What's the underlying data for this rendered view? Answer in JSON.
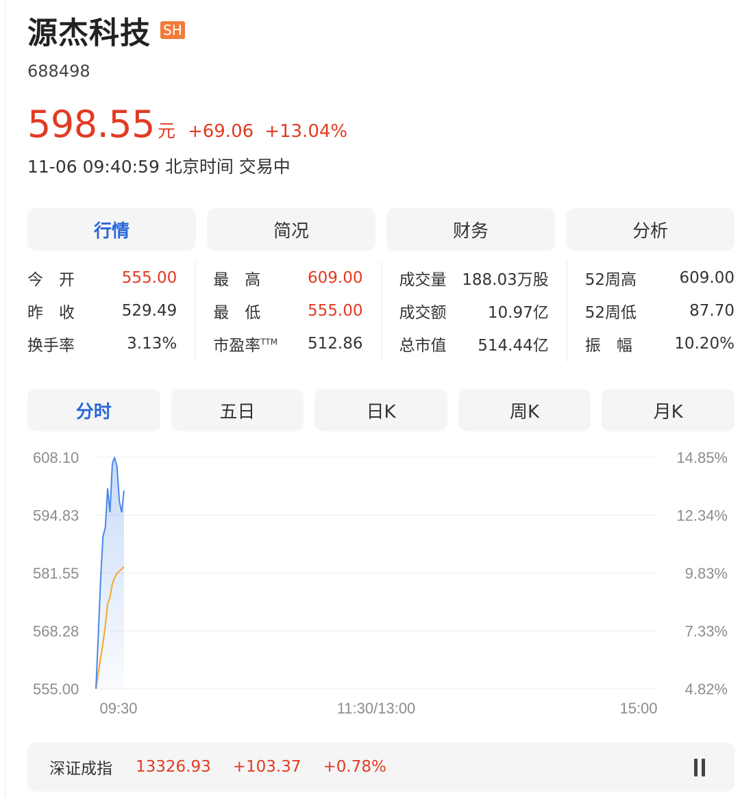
{
  "stock": {
    "name": "源杰科技",
    "exchange": "SH",
    "code": "688498",
    "price": "598.55",
    "unit": "元",
    "change": "+69.06",
    "change_pct": "+13.04%",
    "status": "11-06 09:40:59 北京时间 交易中"
  },
  "tabs": [
    {
      "label": "行情",
      "active": true
    },
    {
      "label": "简况"
    },
    {
      "label": "财务"
    },
    {
      "label": "分析"
    }
  ],
  "quote": {
    "col1": [
      {
        "label": "今　开",
        "value": "555.00",
        "color": "red"
      },
      {
        "label": "昨　收",
        "value": "529.49"
      },
      {
        "label": "换手率",
        "value": "3.13%"
      }
    ],
    "col2": [
      {
        "label": "最　高",
        "value": "609.00",
        "color": "red"
      },
      {
        "label": "最　低",
        "value": "555.00",
        "color": "red"
      },
      {
        "label": "市盈率",
        "label_sup": "TTM",
        "value": "512.86"
      }
    ],
    "col3": [
      {
        "label": "成交量",
        "value": "188.03万股"
      },
      {
        "label": "成交额",
        "value": "10.97亿"
      },
      {
        "label": "总市值",
        "value": "514.44亿"
      }
    ],
    "col4": [
      {
        "label": "52周高",
        "value": "609.00"
      },
      {
        "label": "52周低",
        "value": "87.70"
      },
      {
        "label": "振　幅",
        "value": "10.20%"
      }
    ]
  },
  "period_tabs": [
    {
      "label": "分时",
      "active": true
    },
    {
      "label": "五日"
    },
    {
      "label": "日K"
    },
    {
      "label": "周K"
    },
    {
      "label": "月K"
    }
  ],
  "chart_data": {
    "type": "line",
    "y_ticks": [
      "608.10",
      "594.83",
      "581.55",
      "568.28",
      "555.00"
    ],
    "y_pct_ticks": [
      "14.85%",
      "12.34%",
      "9.83%",
      "7.33%",
      "4.82%"
    ],
    "ylim": [
      555.0,
      608.1
    ],
    "x_ticks": [
      "09:30",
      "11:30/13:00",
      "15:00"
    ],
    "total_minutes": 240,
    "series": [
      {
        "role": "price",
        "color": "#4a86e8",
        "x": [
          0,
          1,
          2,
          3,
          4,
          5,
          6,
          6.5,
          7,
          7.5,
          8,
          9,
          10,
          11,
          12
        ],
        "values": [
          555.0,
          567.0,
          580.0,
          590.0,
          592.0,
          601.0,
          595.5,
          601.0,
          606.5,
          607.5,
          608.0,
          606.0,
          598.0,
          595.5,
          600.5
        ]
      },
      {
        "role": "average",
        "color": "#f5a623",
        "x": [
          0,
          1,
          2,
          3,
          4,
          5,
          6,
          7,
          8,
          9,
          10,
          11,
          12
        ],
        "values": [
          555.0,
          558.5,
          562.0,
          565.5,
          569.5,
          574.5,
          576.0,
          579.0,
          580.5,
          581.5,
          582.0,
          582.5,
          583.0
        ]
      }
    ]
  },
  "index_bar": {
    "name": "深证成指",
    "value": "13326.93",
    "change": "+103.37",
    "change_pct": "+0.78%"
  }
}
